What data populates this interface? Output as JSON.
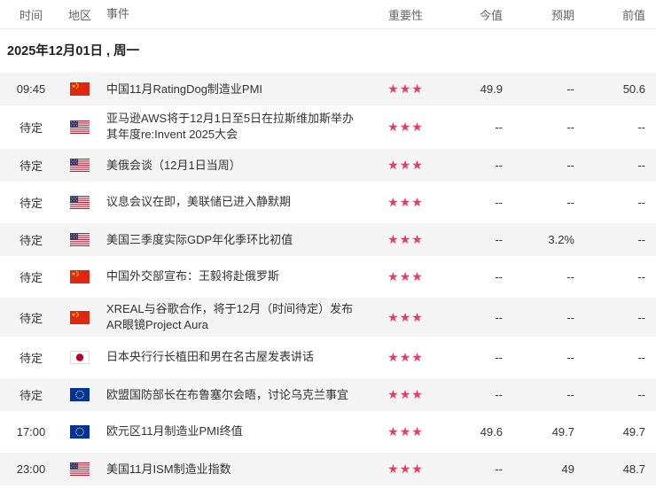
{
  "table": {
    "columns": {
      "time": "时间",
      "region": "地区",
      "event": "事件",
      "importance": "重要性",
      "actual": "今值",
      "forecast": "预期",
      "previous": "前值"
    },
    "date_header": "2025年12月01日 , 周一",
    "star_glyph": "★",
    "empty_value": "--",
    "colors": {
      "importance_star": "#eb3a5c",
      "row_alt_bg": "#f5f5f6",
      "header_text": "#666666",
      "body_text": "#333333",
      "divider": "#e8e8e8",
      "flag_cn_red": "#de2910",
      "flag_us_red": "#b22234",
      "flag_us_blue": "#3c3b6e",
      "flag_jp_red": "#bc002d",
      "flag_eu_blue": "#003399",
      "flag_star_yellow": "#ffde00"
    },
    "rows": [
      {
        "time": "09:45",
        "region": "cn",
        "event": "中国11月RatingDog制造业PMI",
        "importance": 3,
        "actual": "49.9",
        "forecast": "--",
        "previous": "50.6"
      },
      {
        "time": "待定",
        "region": "us",
        "event": "亚马逊AWS将于12月1日至5日在拉斯维加斯举办其年度re:Invent 2025大会",
        "importance": 3,
        "actual": "--",
        "forecast": "--",
        "previous": "--"
      },
      {
        "time": "待定",
        "region": "us",
        "event": "美俄会谈（12月1日当周）",
        "importance": 3,
        "actual": "--",
        "forecast": "--",
        "previous": "--"
      },
      {
        "time": "待定",
        "region": "us",
        "event": "议息会议在即，美联储已进入静默期",
        "importance": 3,
        "actual": "--",
        "forecast": "--",
        "previous": "--"
      },
      {
        "time": "待定",
        "region": "us",
        "event": "美国三季度实际GDP年化季环比初值",
        "importance": 3,
        "actual": "--",
        "forecast": "3.2%",
        "previous": "--"
      },
      {
        "time": "待定",
        "region": "cn",
        "event": "中国外交部宣布：王毅将赴俄罗斯",
        "importance": 3,
        "actual": "--",
        "forecast": "--",
        "previous": "--"
      },
      {
        "time": "待定",
        "region": "cn",
        "event": "XREAL与谷歌合作，将于12月（时间待定）发布AR眼镜Project Aura",
        "importance": 3,
        "actual": "--",
        "forecast": "--",
        "previous": "--"
      },
      {
        "time": "待定",
        "region": "jp",
        "event": "日本央行行长植田和男在名古屋发表讲话",
        "importance": 3,
        "actual": "--",
        "forecast": "--",
        "previous": "--"
      },
      {
        "time": "待定",
        "region": "eu",
        "event": "欧盟国防部长在布鲁塞尔会晤，讨论乌克兰事宜",
        "importance": 3,
        "actual": "--",
        "forecast": "--",
        "previous": "--"
      },
      {
        "time": "17:00",
        "region": "eu",
        "event": "欧元区11月制造业PMI终值",
        "importance": 3,
        "actual": "49.6",
        "forecast": "49.7",
        "previous": "49.7"
      },
      {
        "time": "23:00",
        "region": "us",
        "event": "美国11月ISM制造业指数",
        "importance": 3,
        "actual": "--",
        "forecast": "49",
        "previous": "48.7"
      }
    ]
  }
}
